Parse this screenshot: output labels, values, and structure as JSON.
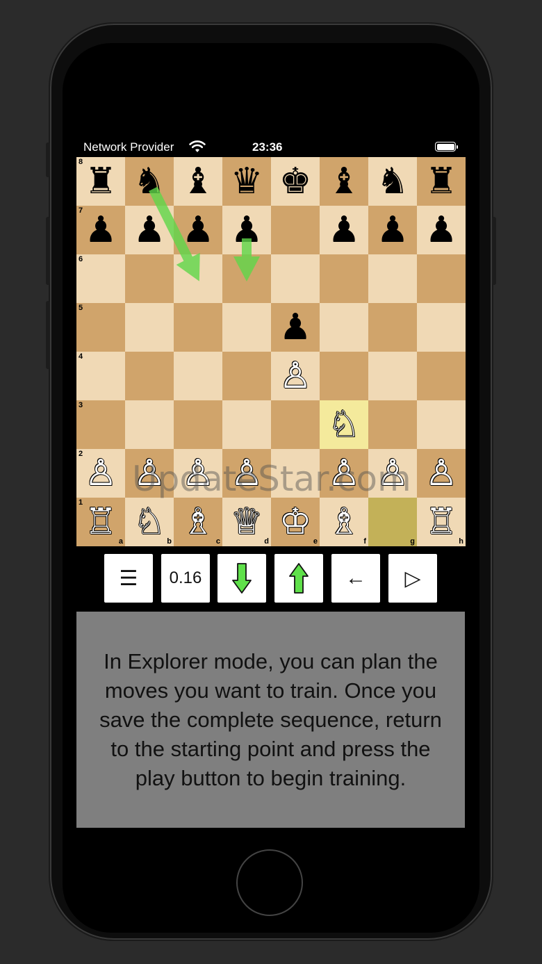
{
  "status_bar": {
    "carrier": "Network Provider",
    "time": "23:36"
  },
  "board": {
    "files": [
      "a",
      "b",
      "c",
      "d",
      "e",
      "f",
      "g",
      "h"
    ],
    "ranks": [
      "8",
      "7",
      "6",
      "5",
      "4",
      "3",
      "2",
      "1"
    ],
    "rows": [
      [
        {
          "p": "♜",
          "c": "black"
        },
        {
          "p": "♞",
          "c": "black"
        },
        {
          "p": "♝",
          "c": "black"
        },
        {
          "p": "♛",
          "c": "black"
        },
        {
          "p": "♚",
          "c": "black"
        },
        {
          "p": "♝",
          "c": "black"
        },
        {
          "p": "♞",
          "c": "black"
        },
        {
          "p": "♜",
          "c": "black"
        }
      ],
      [
        {
          "p": "♟",
          "c": "black"
        },
        {
          "p": "♟",
          "c": "black"
        },
        {
          "p": "♟",
          "c": "black"
        },
        {
          "p": "♟",
          "c": "black"
        },
        null,
        {
          "p": "♟",
          "c": "black"
        },
        {
          "p": "♟",
          "c": "black"
        },
        {
          "p": "♟",
          "c": "black"
        }
      ],
      [
        null,
        null,
        null,
        null,
        null,
        null,
        null,
        null
      ],
      [
        null,
        null,
        null,
        null,
        {
          "p": "♟",
          "c": "black"
        },
        null,
        null,
        null
      ],
      [
        null,
        null,
        null,
        null,
        {
          "p": "♙",
          "c": "white"
        },
        null,
        null,
        null
      ],
      [
        null,
        null,
        null,
        null,
        null,
        {
          "p": "♘",
          "c": "white"
        },
        null,
        null
      ],
      [
        {
          "p": "♙",
          "c": "white"
        },
        {
          "p": "♙",
          "c": "white"
        },
        {
          "p": "♙",
          "c": "white"
        },
        {
          "p": "♙",
          "c": "white"
        },
        null,
        {
          "p": "♙",
          "c": "white"
        },
        {
          "p": "♙",
          "c": "white"
        },
        {
          "p": "♙",
          "c": "white"
        }
      ],
      [
        {
          "p": "♖",
          "c": "white"
        },
        {
          "p": "♘",
          "c": "white"
        },
        {
          "p": "♗",
          "c": "white"
        },
        {
          "p": "♕",
          "c": "white"
        },
        {
          "p": "♔",
          "c": "white"
        },
        {
          "p": "♗",
          "c": "white"
        },
        null,
        {
          "p": "♖",
          "c": "white"
        }
      ]
    ],
    "highlighted_squares": [
      "f3",
      "g1"
    ],
    "arrows": [
      {
        "from": "b8",
        "to": "c6",
        "color": "#5fd64a"
      },
      {
        "from": "d7",
        "to": "d6",
        "color": "#5fd64a"
      }
    ]
  },
  "toolbar": {
    "menu_icon": "☰",
    "eval_value": "0.16",
    "back_icon": "←",
    "play_icon": "▷"
  },
  "info_text": "In Explorer mode, you can plan the moves you want to train. Once you save the complete sequence, return to the starting point and press the play button to begin training.",
  "watermark": "UpdateStar.com"
}
